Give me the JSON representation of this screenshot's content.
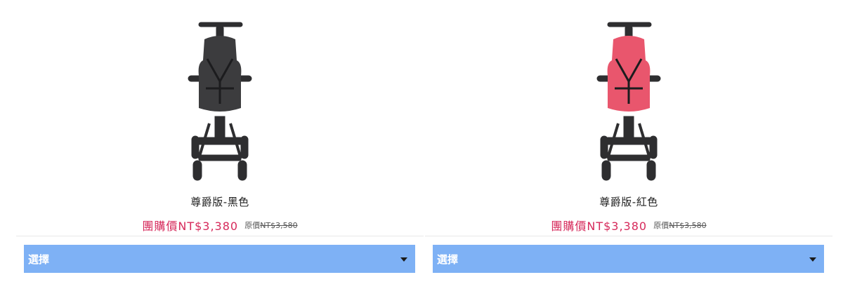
{
  "products": [
    {
      "title": "尊爵版-黑色",
      "group_price": "團購價NT$3,380",
      "original_label": "原價",
      "original_price": "NT$3,580",
      "select_label": "選擇",
      "image_color": "#3c3c3e",
      "image_icon": "stroller-black"
    },
    {
      "title": "尊爵版-紅色",
      "group_price": "團購價NT$3,380",
      "original_label": "原價",
      "original_price": "NT$3,580",
      "select_label": "選擇",
      "image_color": "#e9566d",
      "image_icon": "stroller-red"
    }
  ],
  "colors": {
    "price": "#d62a5b",
    "select_bg": "#7eb1f5",
    "frame": "#2e2e30"
  }
}
